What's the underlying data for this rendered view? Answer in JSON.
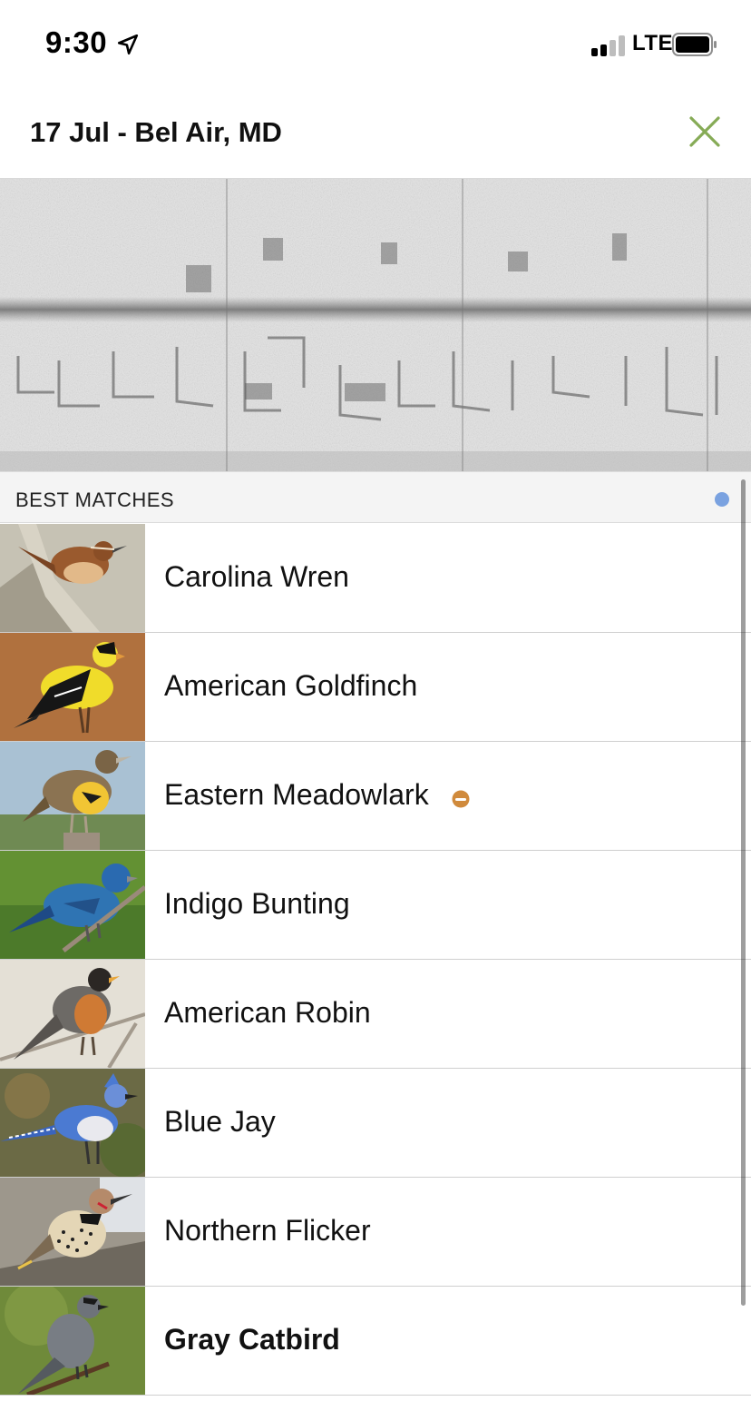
{
  "status_bar": {
    "time": "9:30",
    "network": "LTE"
  },
  "header": {
    "title": "17 Jul - Bel Air, MD"
  },
  "section": {
    "title": "BEST MATCHES"
  },
  "colors": {
    "accent_green": "#86ab56",
    "indicator_blue": "#7aa2e0",
    "rare_badge_orange": "#d08a3c"
  },
  "icons": {
    "close": "close-x-icon",
    "location": "location-arrow-icon",
    "signal": "cellular-signal-icon",
    "battery": "battery-icon",
    "rare": "rare-species-icon"
  },
  "matches": [
    {
      "name": "Carolina Wren",
      "bold": false,
      "rare": false
    },
    {
      "name": "American Goldfinch",
      "bold": false,
      "rare": false
    },
    {
      "name": "Eastern Meadowlark",
      "bold": false,
      "rare": true
    },
    {
      "name": "Indigo Bunting",
      "bold": false,
      "rare": false
    },
    {
      "name": "American Robin",
      "bold": false,
      "rare": false
    },
    {
      "name": "Blue Jay",
      "bold": false,
      "rare": false
    },
    {
      "name": "Northern Flicker",
      "bold": false,
      "rare": false
    },
    {
      "name": "Gray Catbird",
      "bold": true,
      "rare": false
    }
  ]
}
